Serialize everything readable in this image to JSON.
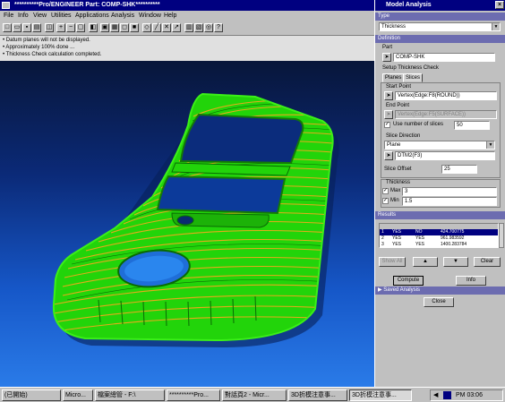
{
  "main_window": {
    "title": "**********Pro/ENGINEER Part: COMP-SHK**********",
    "menu": [
      "File",
      "Info",
      "View",
      "Utilities",
      "Applications",
      "Analysis",
      "Window",
      "Help"
    ],
    "messages": [
      "• Datum planes will not be displayed.",
      "• Approximately 100% done ...",
      "• Thickness Check calculation completed."
    ]
  },
  "dialog": {
    "title": "Model Analysis",
    "type_section": "Type",
    "type_value": "Thickness",
    "definition_section": "Definition",
    "part_label": "Part",
    "part_value": "COMP-SHK",
    "setup_label": "Setup Thickness Check",
    "tabs": [
      "Planes",
      "Slices"
    ],
    "start_point_label": "Start Point",
    "start_point_value": "Vertex(Edge:F8(ROUND))",
    "end_point_label": "End Point",
    "end_point_value": "Vertex(Edge:F5(SURFACE))",
    "use_slices_label": "Use number of slices",
    "slices_value": "50",
    "slice_direction_label": "Slice Direction",
    "slice_direction_value": "Plane",
    "plane_value": "DTM2(F3)",
    "slice_offset_label": "Slice Offset",
    "slice_offset_value": "25",
    "thickness_label": "Thickness",
    "max_label": "Max",
    "max_value": "3",
    "min_label": "Min",
    "min_value": "1.5",
    "results_section": "Results",
    "results_rows": [
      [
        "1",
        "YES",
        "NO",
        "424.700775"
      ],
      [
        "2",
        "YES",
        "YES",
        "961.983592"
      ],
      [
        "3",
        "YES",
        "YES",
        "1400.283784"
      ]
    ],
    "show_all_label": "Show All",
    "clear_label": "Clear",
    "compute_label": "Compute",
    "info_label": "Info",
    "saved_analysis_label": "Saved Analysis",
    "close_label": "Close"
  },
  "taskbar": {
    "items": [
      "(已開始)",
      "Micro...",
      "檔案總管 - F:\\",
      "**********Pro...",
      "對話頁2 - Micr...",
      "3D折模注意事...",
      "3D折模注意事..."
    ],
    "clock": "PM 03:06"
  },
  "colors": {
    "title_bar": "#000080",
    "window_face": "#c0c0c0",
    "section_header": "#6c6cb0",
    "model_green": "#22d40a",
    "model_slice": "#f0a81e"
  }
}
